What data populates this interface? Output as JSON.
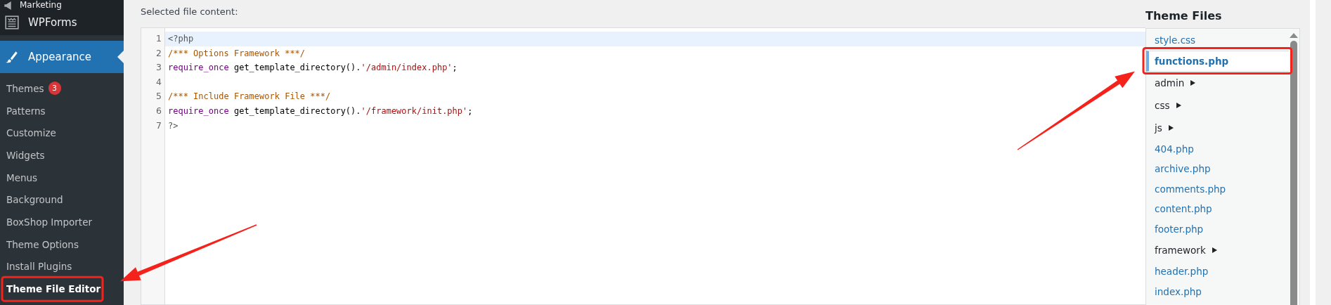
{
  "sidebar": {
    "items": [
      {
        "label": "Marketing",
        "selected": false
      },
      {
        "label": "WPForms",
        "selected": false
      },
      {
        "label": "Appearance",
        "selected": true,
        "children": [
          {
            "label": "Themes",
            "badge": "3",
            "selected": false,
            "highlighted": false
          },
          {
            "label": "Patterns",
            "selected": false,
            "highlighted": false
          },
          {
            "label": "Customize",
            "selected": false,
            "highlighted": false
          },
          {
            "label": "Widgets",
            "selected": false,
            "highlighted": false
          },
          {
            "label": "Menus",
            "selected": false,
            "highlighted": false
          },
          {
            "label": "Background",
            "selected": false,
            "highlighted": false
          },
          {
            "label": "BoxShop Importer",
            "selected": false,
            "highlighted": false
          },
          {
            "label": "Theme Options",
            "selected": false,
            "highlighted": false
          },
          {
            "label": "Install Plugins",
            "selected": false,
            "highlighted": false
          },
          {
            "label": "Theme File Editor",
            "selected": true,
            "highlighted": true
          }
        ]
      }
    ]
  },
  "editor": {
    "label": "Selected file content:",
    "lines": [
      {
        "number": "1",
        "current": true,
        "tokens": [
          {
            "kind": "meta",
            "text": "<?php"
          }
        ]
      },
      {
        "number": "2",
        "current": false,
        "tokens": [
          {
            "kind": "comment",
            "text": "/*** Options Framework ***/"
          }
        ]
      },
      {
        "number": "3",
        "current": false,
        "tokens": [
          {
            "kind": "keyword",
            "text": "require_once"
          },
          {
            "kind": "plain",
            "text": " get_template_directory()."
          },
          {
            "kind": "string",
            "text": "'/admin/index.php'"
          },
          {
            "kind": "plain",
            "text": ";"
          }
        ]
      },
      {
        "number": "4",
        "current": false
      },
      {
        "number": "5",
        "current": false,
        "tokens": [
          {
            "kind": "comment",
            "text": "/*** Include Framework File ***/"
          }
        ]
      },
      {
        "number": "6",
        "current": false,
        "tokens": [
          {
            "kind": "keyword",
            "text": "require_once"
          },
          {
            "kind": "plain",
            "text": " get_template_directory()."
          },
          {
            "kind": "string",
            "text": "'/framework/init.php'"
          },
          {
            "kind": "plain",
            "text": ";"
          }
        ]
      },
      {
        "number": "7",
        "current": false,
        "tokens": [
          {
            "kind": "meta",
            "text": "?>"
          }
        ]
      }
    ]
  },
  "theme_files": {
    "title": "Theme Files",
    "items": [
      {
        "label": "style.css",
        "kind": "file",
        "selected": false,
        "highlighted": false
      },
      {
        "label": "functions.php",
        "kind": "file",
        "selected": true,
        "highlighted": true
      },
      {
        "label": "admin",
        "kind": "folder",
        "expanded": false
      },
      {
        "label": "css",
        "kind": "folder",
        "expanded": false
      },
      {
        "label": "js",
        "kind": "folder",
        "expanded": false
      },
      {
        "label": "404.php",
        "kind": "file",
        "selected": false,
        "highlighted": false
      },
      {
        "label": "archive.php",
        "kind": "file",
        "selected": false,
        "highlighted": false
      },
      {
        "label": "comments.php",
        "kind": "file",
        "selected": false,
        "highlighted": false
      },
      {
        "label": "content.php",
        "kind": "file",
        "selected": false,
        "highlighted": false
      },
      {
        "label": "footer.php",
        "kind": "file",
        "selected": false,
        "highlighted": false
      },
      {
        "label": "framework",
        "kind": "folder",
        "expanded": false
      },
      {
        "label": "header.php",
        "kind": "file",
        "selected": false,
        "highlighted": false
      },
      {
        "label": "index.php",
        "kind": "file",
        "selected": false,
        "highlighted": false
      }
    ]
  }
}
